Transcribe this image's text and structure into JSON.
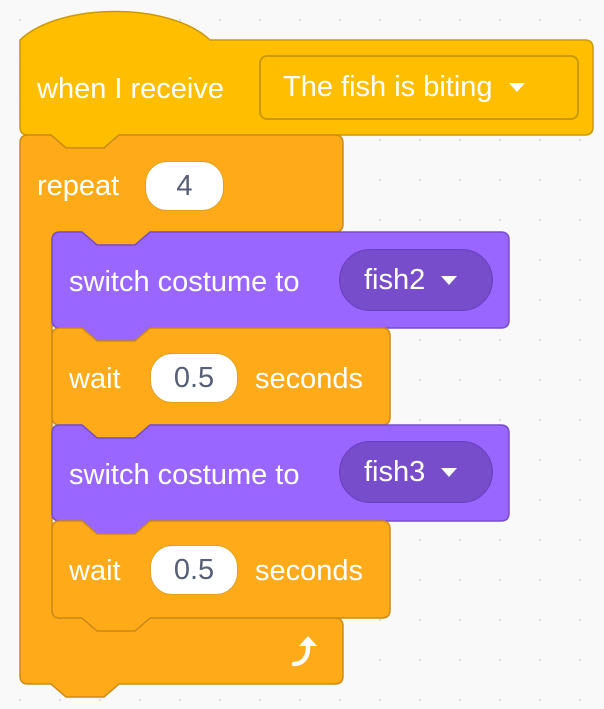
{
  "hat": {
    "label": "when I receive",
    "message": "The fish is biting",
    "dropdown_icon": "caret-down-icon"
  },
  "repeat": {
    "label": "repeat",
    "count": "4",
    "loop_icon": "loop-arrow-icon"
  },
  "body": [
    {
      "type": "switch-costume",
      "label": "switch costume to",
      "costume": "fish2"
    },
    {
      "type": "wait",
      "label": "wait",
      "value": "0.5",
      "unit": "seconds"
    },
    {
      "type": "switch-costume",
      "label": "switch costume to",
      "costume": "fish3"
    },
    {
      "type": "wait",
      "label": "wait",
      "value": "0.5",
      "unit": "seconds"
    }
  ],
  "colors": {
    "events": "#ffbf00",
    "control": "#ffab19",
    "looks": "#9966ff",
    "looks_dropdown": "#774dcb",
    "input_text": "#575e75"
  }
}
